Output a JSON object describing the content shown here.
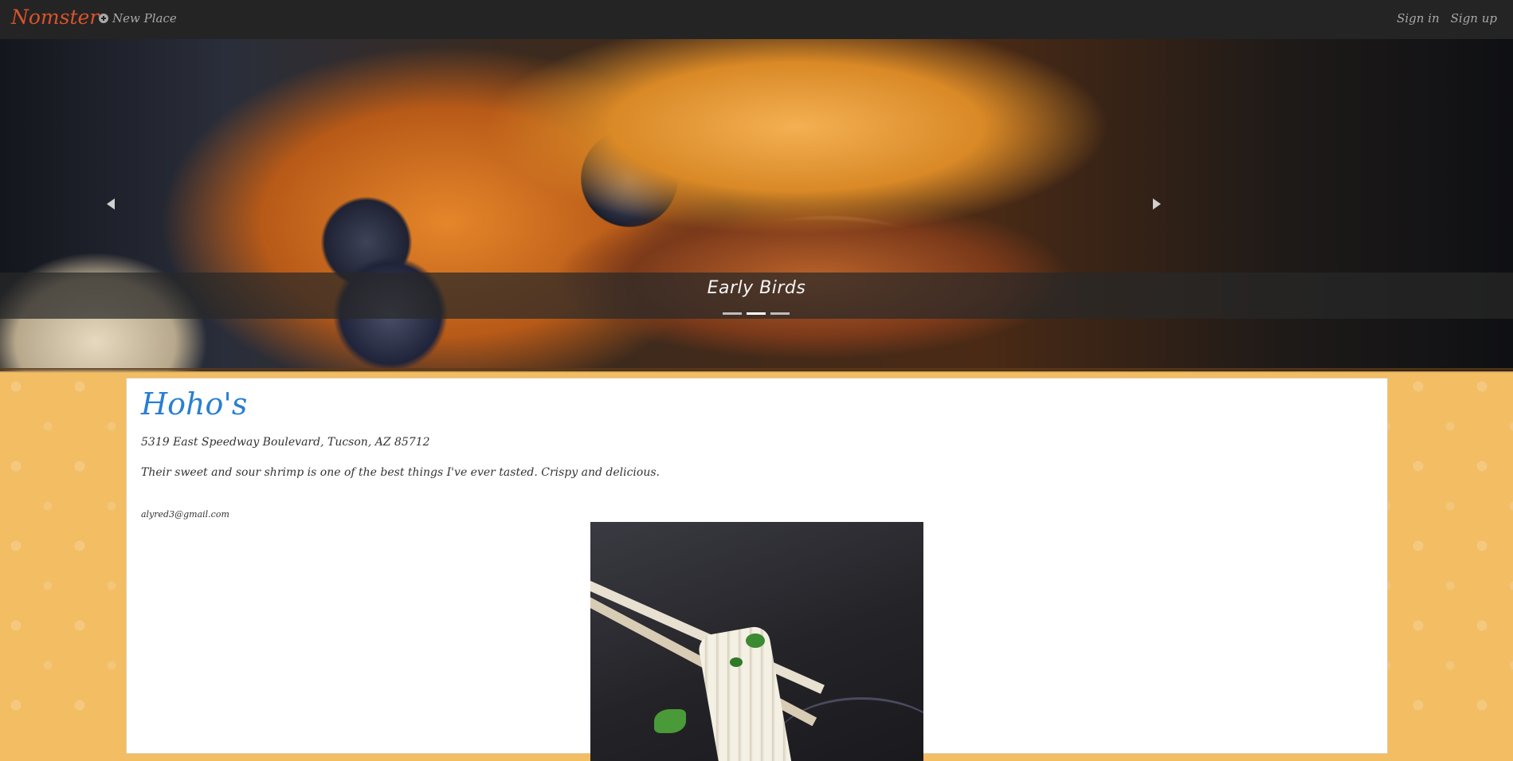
{
  "navbar": {
    "brand": "Nomster",
    "new_place": "New Place",
    "sign_in": "Sign in",
    "sign_up": "Sign up"
  },
  "hero": {
    "caption": "Early Birds",
    "slide_count": 3,
    "active_slide": 2
  },
  "place": {
    "name": "Hoho's",
    "address": "5319 East Speedway Boulevard, Tucson, AZ 85712",
    "description": "Their sweet and sour shrimp is one of the best things I've ever tasted. Crispy and delicious.",
    "email": "alyred3@gmail.com"
  },
  "colors": {
    "brand": "#d9542a",
    "navbar_bg": "#242424",
    "page_bg": "#f2bd63",
    "title": "#2a7fd0"
  }
}
